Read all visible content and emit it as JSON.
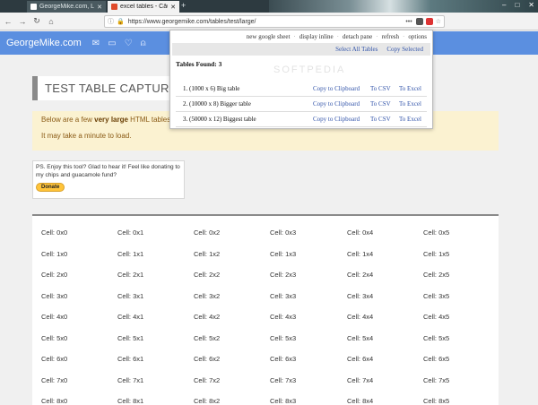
{
  "browser": {
    "tabs": [
      {
        "title": "GeorgeMike.com, Large Table",
        "active": false
      },
      {
        "title": "excel tables - Căutare Google",
        "active": true
      }
    ],
    "url": "https://www.georgemike.com/tables/test/large/"
  },
  "site": {
    "brand": "GeorgeMike.com"
  },
  "page": {
    "title": "TEST TABLE CAPTUR",
    "notice_line1_pre": "Below are a few ",
    "notice_line1_bold": "very large",
    "notice_line1_post": " HTML tables t",
    "notice_line2": "It may take a minute to load.",
    "donate_text": "PS. Enjoy this tool? Glad to hear it! Feel like donating to my chips and guacamole fund?",
    "donate_button": "Donate"
  },
  "popup": {
    "links": [
      "new google sheet",
      "display inline",
      "detach pane",
      "refresh",
      "options"
    ],
    "select_all": "Select All Tables",
    "copy_selected": "Copy Selected",
    "found_label": "Tables Found: 3",
    "tables": [
      {
        "name": "1. (1000 x 6) Big table",
        "copy": "Copy to Clipboard",
        "csv": "To CSV",
        "excel": "To Excel"
      },
      {
        "name": "2. (10000 x 8) Bigger table",
        "copy": "Copy to Clipboard",
        "csv": "To CSV",
        "excel": "To Excel"
      },
      {
        "name": "3. (50000 x 12) Biggest table",
        "copy": "Copy to Clipboard",
        "csv": "To CSV",
        "excel": "To Excel"
      }
    ],
    "watermark": "SOFTPEDIA"
  },
  "table": {
    "rows": [
      [
        "Cell: 0x0",
        "Cell: 0x1",
        "Cell: 0x2",
        "Cell: 0x3",
        "Cell: 0x4",
        "Cell: 0x5"
      ],
      [
        "Cell: 1x0",
        "Cell: 1x1",
        "Cell: 1x2",
        "Cell: 1x3",
        "Cell: 1x4",
        "Cell: 1x5"
      ],
      [
        "Cell: 2x0",
        "Cell: 2x1",
        "Cell: 2x2",
        "Cell: 2x3",
        "Cell: 2x4",
        "Cell: 2x5"
      ],
      [
        "Cell: 3x0",
        "Cell: 3x1",
        "Cell: 3x2",
        "Cell: 3x3",
        "Cell: 3x4",
        "Cell: 3x5"
      ],
      [
        "Cell: 4x0",
        "Cell: 4x1",
        "Cell: 4x2",
        "Cell: 4x3",
        "Cell: 4x4",
        "Cell: 4x5"
      ],
      [
        "Cell: 5x0",
        "Cell: 5x1",
        "Cell: 5x2",
        "Cell: 5x3",
        "Cell: 5x4",
        "Cell: 5x5"
      ],
      [
        "Cell: 6x0",
        "Cell: 6x1",
        "Cell: 6x2",
        "Cell: 6x3",
        "Cell: 6x4",
        "Cell: 6x5"
      ],
      [
        "Cell: 7x0",
        "Cell: 7x1",
        "Cell: 7x2",
        "Cell: 7x3",
        "Cell: 7x4",
        "Cell: 7x5"
      ],
      [
        "Cell: 8x0",
        "Cell: 8x1",
        "Cell: 8x2",
        "Cell: 8x3",
        "Cell: 8x4",
        "Cell: 8x5"
      ]
    ]
  },
  "colors": {
    "header_blue": "#5b8fe0",
    "notice_bg": "#fbf2d1",
    "link_blue": "#3355aa"
  }
}
